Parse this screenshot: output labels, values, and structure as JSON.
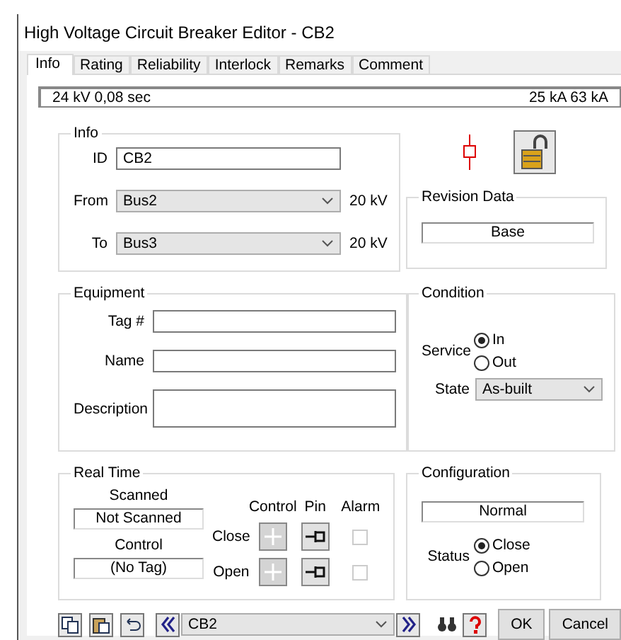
{
  "window": {
    "title": "High Voltage Circuit Breaker Editor - CB2"
  },
  "tabs": [
    {
      "label": "Info",
      "selected": true
    },
    {
      "label": "Rating",
      "selected": false
    },
    {
      "label": "Reliability",
      "selected": false
    },
    {
      "label": "Interlock",
      "selected": false
    },
    {
      "label": "Remarks",
      "selected": false
    },
    {
      "label": "Comment",
      "selected": false
    }
  ],
  "status_bar": {
    "left": "24 kV  0,08 sec",
    "right": "25 kA  63 kA"
  },
  "info": {
    "title": "Info",
    "id_label": "ID",
    "id_value": "CB2",
    "from": {
      "label": "From",
      "value": "Bus2",
      "kv": "20 kV"
    },
    "to": {
      "label": "To",
      "value": "Bus3",
      "kv": "20 kV"
    }
  },
  "revision": {
    "title": "Revision Data",
    "value": "Base"
  },
  "equipment": {
    "title": "Equipment",
    "fields": [
      {
        "label": "Tag #",
        "kind": "line"
      },
      {
        "label": "Name",
        "kind": "line"
      },
      {
        "label": "Description",
        "kind": "area"
      }
    ]
  },
  "condition": {
    "title": "Condition",
    "service_label": "Service",
    "service_options": [
      {
        "label": "In",
        "selected": true
      },
      {
        "label": "Out",
        "selected": false
      }
    ],
    "state_label": "State",
    "state_value": "As-built"
  },
  "real_time": {
    "title": "Real Time",
    "scanned_label": "Scanned",
    "scanned_value": "Not Scanned",
    "control_label": "Control",
    "control_value": "(No Tag)",
    "headers": [
      "Control",
      "Pin",
      "Alarm"
    ],
    "rows": [
      {
        "label": "Close",
        "disabled": true,
        "checked": false
      },
      {
        "label": "Open",
        "disabled": true,
        "checked": false
      }
    ]
  },
  "configuration": {
    "title": "Configuration",
    "value": "Normal",
    "status_label": "Status",
    "status_options": [
      {
        "label": "Close",
        "selected": true
      },
      {
        "label": "Open",
        "selected": false
      }
    ]
  },
  "toolbar": {
    "selector_value": "CB2",
    "ok": "OK",
    "cancel": "Cancel"
  }
}
